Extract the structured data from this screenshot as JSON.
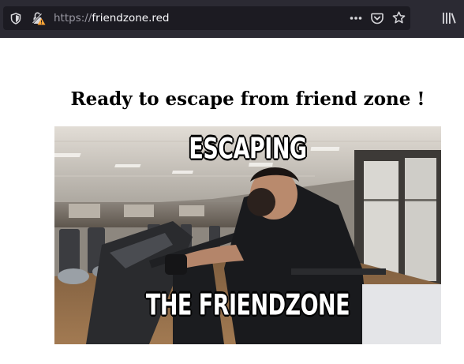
{
  "browser": {
    "url_scheme": "https://",
    "url_host": "friendzone.red",
    "icons": {
      "tracking": "shield-icon",
      "security": "insecure-lock-icon",
      "page_actions": "ellipsis-icon",
      "pocket": "pocket-icon",
      "bookmark": "star-icon",
      "library": "library-icon"
    }
  },
  "page": {
    "title": "Ready to escape from friend zone !",
    "meme": {
      "top_caption": "ESCAPING",
      "bottom_caption": "THE FRIENDZONE"
    }
  },
  "colors": {
    "toolbar": "#2b2a33",
    "urlbar": "#1c1b22",
    "warning": "#ffa436"
  }
}
